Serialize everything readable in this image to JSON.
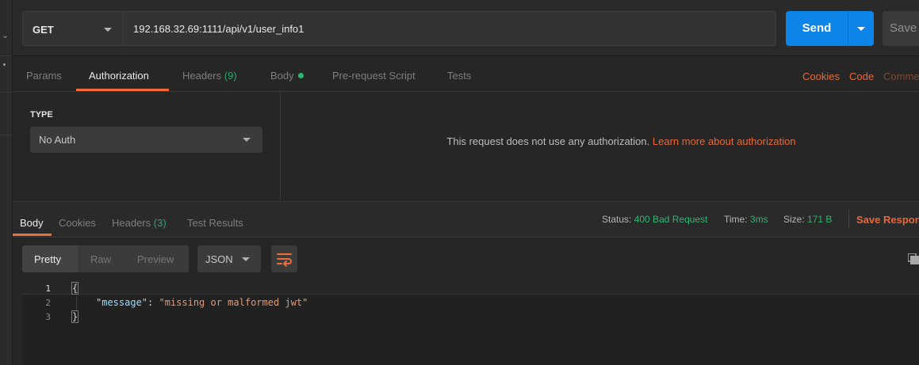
{
  "request": {
    "method": "GET",
    "url": "192.168.32.69:1111/api/v1/user_info1",
    "send_label": "Send",
    "save_label": "Save"
  },
  "request_tabs": {
    "params": "Params",
    "authorization": "Authorization",
    "headers": "Headers",
    "headers_count": "(9)",
    "body": "Body",
    "prerequest": "Pre-request Script",
    "tests": "Tests",
    "cookies": "Cookies",
    "code": "Code",
    "comments": "Comme"
  },
  "auth": {
    "type_label": "TYPE",
    "type_value": "No Auth",
    "message": "This request does not use any authorization.",
    "learn_more": "Learn more about authorization"
  },
  "response_tabs": {
    "body": "Body",
    "cookies": "Cookies",
    "headers": "Headers",
    "headers_count": "(3)",
    "test_results": "Test Results"
  },
  "response_meta": {
    "status_label": "Status:",
    "status_value": "400 Bad Request",
    "time_label": "Time:",
    "time_value": "3ms",
    "size_label": "Size:",
    "size_value": "171 B",
    "save_response": "Save Respon"
  },
  "response_view": {
    "pretty": "Pretty",
    "raw": "Raw",
    "preview": "Preview",
    "format": "JSON"
  },
  "code": {
    "line_numbers": [
      "1",
      "2",
      "3"
    ],
    "open_brace": "{",
    "key": "\"message\"",
    "colon": ": ",
    "value": "\"missing or malformed jwt\"",
    "close_brace": "}"
  },
  "colors": {
    "accent": "#f26b3a",
    "send_blue": "#0d84e8",
    "status_green": "#2fb56f"
  }
}
